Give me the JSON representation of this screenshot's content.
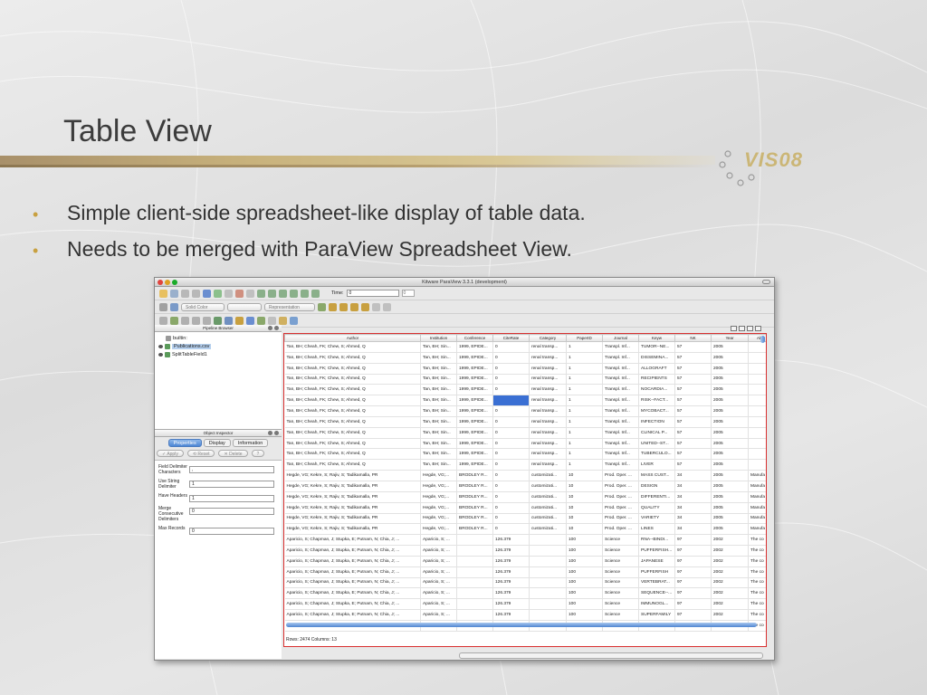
{
  "slide": {
    "title": "Table View",
    "logo_text": "VIS08",
    "bullets": [
      "Simple client-side spreadsheet-like display of table data.",
      "Needs to be merged with ParaView Spreadsheet View."
    ],
    "accent": "#c8a040"
  },
  "window": {
    "title": "Kitware ParaView 3.3.1 (development)",
    "toolbar": {
      "time_label": "Time:",
      "time_value": "0",
      "time_step": "0",
      "color_combo": "Solid Color",
      "representation_combo": "Representation"
    },
    "pipeline_browser": {
      "title": "Pipeline Browser",
      "items": [
        "builtin:",
        "Publications.csv",
        "SplitTableField1"
      ]
    },
    "object_inspector": {
      "title": "Object Inspector",
      "tabs": [
        "Properties",
        "Display",
        "Information"
      ],
      "buttons": {
        "apply": "Apply",
        "reset": "Reset",
        "delete": "Delete",
        "help": "?"
      },
      "properties": [
        {
          "label": "Field Delimiter Characters",
          "value": ","
        },
        {
          "label": "Use String Delimiter",
          "value": "1"
        },
        {
          "label": "Have Headers",
          "value": "1"
        },
        {
          "label": "Merge Consecutive Delimiters",
          "value": "0"
        },
        {
          "label": "Max Records",
          "value": "0"
        }
      ]
    },
    "table": {
      "columns": [
        "Author",
        "Institution",
        "Conference",
        "CiteRate",
        "Category",
        "PaperID",
        "Journal",
        "Keyw",
        "NK",
        "Year",
        "Abst"
      ],
      "rows": [
        [
          "Tan, BH; Cheah, FK; Chew, S; Ahmed, Q",
          "Tan, BH; Sin...",
          "1999, EPIDE...",
          "0",
          "renal transp...",
          "1",
          "Transpl. Inf...",
          "TUMOR--NE...",
          "57",
          "2005",
          ""
        ],
        [
          "Tan, BH; Cheah, FK; Chew, S; Ahmed, Q",
          "Tan, BH; Sin...",
          "1999, EPIDE...",
          "0",
          "renal transp...",
          "1",
          "Transpl. Inf...",
          "DISSEMINA...",
          "57",
          "2005",
          ""
        ],
        [
          "Tan, BH; Cheah, FK; Chew, S; Ahmed, Q",
          "Tan, BH; Sin...",
          "1999, EPIDE...",
          "0",
          "renal transp...",
          "1",
          "Transpl. Inf...",
          "ALLOGRAFT",
          "57",
          "2005",
          ""
        ],
        [
          "Tan, BH; Cheah, FK; Chew, S; Ahmed, Q",
          "Tan, BH; Sin...",
          "1999, EPIDE...",
          "0",
          "renal transp...",
          "1",
          "Transpl. Inf...",
          "RECIPIENTS",
          "57",
          "2005",
          ""
        ],
        [
          "Tan, BH; Cheah, FK; Chew, S; Ahmed, Q",
          "Tan, BH; Sin...",
          "1999, EPIDE...",
          "0",
          "renal transp...",
          "1",
          "Transpl. Inf...",
          "NOCARDIA...",
          "57",
          "2005",
          ""
        ],
        [
          "Tan, BH; Cheah, FK; Chew, S; Ahmed, Q",
          "Tan, BH; Sin...",
          "1999, EPIDE...",
          "0",
          "renal transp...",
          "1",
          "Transpl. Inf...",
          "RISK--FACT...",
          "57",
          "2005",
          ""
        ],
        [
          "Tan, BH; Cheah, FK; Chew, S; Ahmed, Q",
          "Tan, BH; Sin...",
          "1999, EPIDE...",
          "0",
          "renal transp...",
          "1",
          "Transpl. Inf...",
          "MYCOBACT...",
          "57",
          "2005",
          ""
        ],
        [
          "Tan, BH; Cheah, FK; Chew, S; Ahmed, Q",
          "Tan, BH; Sin...",
          "1999, EPIDE...",
          "0",
          "renal transp...",
          "1",
          "Transpl. Inf...",
          "INFECTION",
          "57",
          "2005",
          ""
        ],
        [
          "Tan, BH; Cheah, FK; Chew, S; Ahmed, Q",
          "Tan, BH; Sin...",
          "1999, EPIDE...",
          "0",
          "renal transp...",
          "1",
          "Transpl. Inf...",
          "CLINICAL P...",
          "57",
          "2005",
          ""
        ],
        [
          "Tan, BH; Cheah, FK; Chew, S; Ahmed, Q",
          "Tan, BH; Sin...",
          "1999, EPIDE...",
          "0",
          "renal transp...",
          "1",
          "Transpl. Inf...",
          "UNITED--ST...",
          "57",
          "2005",
          ""
        ],
        [
          "Tan, BH; Cheah, FK; Chew, S; Ahmed, Q",
          "Tan, BH; Sin...",
          "1999, EPIDE...",
          "0",
          "renal transp...",
          "1",
          "Transpl. Inf...",
          "TUBERCULO...",
          "57",
          "2005",
          ""
        ],
        [
          "Tan, BH; Cheah, FK; Chew, S; Ahmed, Q",
          "Tan, BH; Sin...",
          "1999, EPIDE...",
          "0",
          "renal transp...",
          "1",
          "Transpl. Inf...",
          "LIVER",
          "57",
          "2005",
          ""
        ],
        [
          "Hegde, VG; Kekre, S; Rajiv, S; Tadikamalla, PR",
          "Hegde, VG;...",
          "BRODLEY R...",
          "0",
          "customizati...",
          "10",
          "Prod. Oper. ...",
          "MASS CUST...",
          "34",
          "2005",
          "Manufa"
        ],
        [
          "Hegde, VG; Kekre, S; Rajiv, S; Tadikamalla, PR",
          "Hegde, VG;...",
          "BRODLEY R...",
          "0",
          "customizati...",
          "10",
          "Prod. Oper. ...",
          "DESIGN",
          "34",
          "2005",
          "Manufa"
        ],
        [
          "Hegde, VG; Kekre, S; Rajiv, S; Tadikamalla, PR",
          "Hegde, VG;...",
          "BRODLEY R...",
          "0",
          "customizati...",
          "10",
          "Prod. Oper. ...",
          "DIFFERENTI...",
          "34",
          "2005",
          "Manufa"
        ],
        [
          "Hegde, VG; Kekre, S; Rajiv, S; Tadikamalla, PR",
          "Hegde, VG;...",
          "BRODLEY R...",
          "0",
          "customizati...",
          "10",
          "Prod. Oper. ...",
          "QUALITY",
          "34",
          "2005",
          "Manufa"
        ],
        [
          "Hegde, VG; Kekre, S; Rajiv, S; Tadikamalla, PR",
          "Hegde, VG;...",
          "BRODLEY R...",
          "0",
          "customizati...",
          "10",
          "Prod. Oper. ...",
          "VARIETY",
          "34",
          "2005",
          "Manufa"
        ],
        [
          "Hegde, VG; Kekre, S; Rajiv, S; Tadikamalla, PR",
          "Hegde, VG;...",
          "BRODLEY R...",
          "0",
          "customizati...",
          "10",
          "Prod. Oper. ...",
          "LINES",
          "34",
          "2005",
          "Manufa"
        ],
        [
          "Aparicio, S; Chapman, J; Stupka, E; Putnam, N; Chia, J; ...",
          "Aparicio, S; ...",
          "",
          "126.379",
          "",
          "100",
          "Science",
          "RNA--BINDI...",
          "97",
          "2002",
          "The co"
        ],
        [
          "Aparicio, S; Chapman, J; Stupka, E; Putnam, N; Chia, J; ...",
          "Aparicio, S; ...",
          "",
          "126.379",
          "",
          "100",
          "Science",
          "PUFFERFISH...",
          "97",
          "2002",
          "The co"
        ],
        [
          "Aparicio, S; Chapman, J; Stupka, E; Putnam, N; Chia, J; ...",
          "Aparicio, S; ...",
          "",
          "126.379",
          "",
          "100",
          "Science",
          "JAPANESE",
          "97",
          "2002",
          "The co"
        ],
        [
          "Aparicio, S; Chapman, J; Stupka, E; Putnam, N; Chia, J; ...",
          "Aparicio, S; ...",
          "",
          "126.379",
          "",
          "100",
          "Science",
          "PUFFERFISH",
          "97",
          "2002",
          "The co"
        ],
        [
          "Aparicio, S; Chapman, J; Stupka, E; Putnam, N; Chia, J; ...",
          "Aparicio, S; ...",
          "",
          "126.379",
          "",
          "100",
          "Science",
          "VERTEBRAT...",
          "97",
          "2002",
          "The co"
        ],
        [
          "Aparicio, S; Chapman, J; Stupka, E; Putnam, N; Chia, J; ...",
          "Aparicio, S; ...",
          "",
          "126.379",
          "",
          "100",
          "Science",
          "SEQUENCE--...",
          "97",
          "2002",
          "The co"
        ],
        [
          "Aparicio, S; Chapman, J; Stupka, E; Putnam, N; Chia, J; ...",
          "Aparicio, S; ...",
          "",
          "126.379",
          "",
          "100",
          "Science",
          "IMMUNOGL...",
          "97",
          "2002",
          "The co"
        ],
        [
          "Aparicio, S; Chapman, J; Stupka, E; Putnam, N; Chia, J; ...",
          "Aparicio, S; ...",
          "",
          "126.379",
          "",
          "100",
          "Science",
          "SUPERFAMILY",
          "97",
          "2002",
          "The co"
        ],
        [
          "Aparicio, S; Chapman, J; Stupka, E; Putnam, N; Chia, J; ...",
          "Aparicio, S; ...",
          "",
          "126.379",
          "",
          "100",
          "Science",
          "DROSOPHIL...",
          "97",
          "2002",
          "The co"
        ]
      ],
      "selected_cell": {
        "row": 5,
        "col": 3
      },
      "status": "Rows: 2474  Columns: 13",
      "highlight_color": "#d83030"
    }
  }
}
